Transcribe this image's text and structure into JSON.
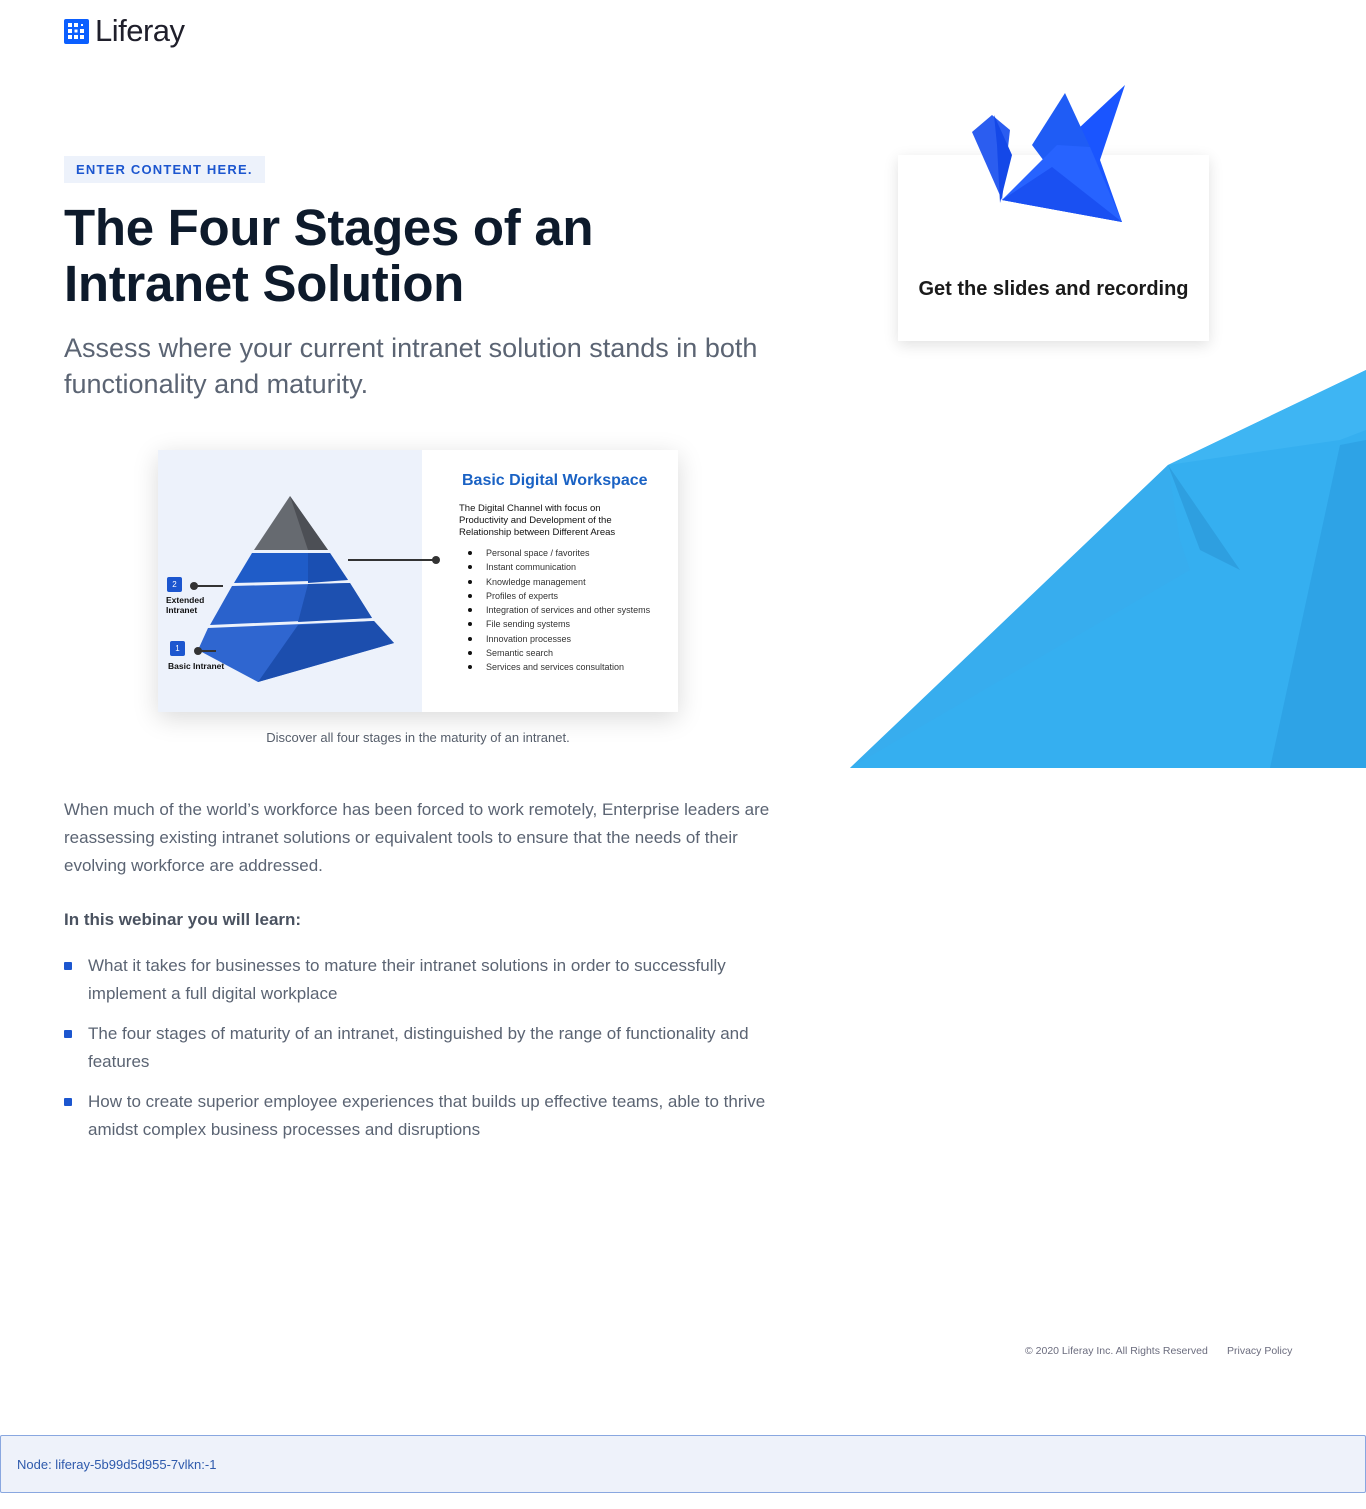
{
  "brand": {
    "name": "Liferay"
  },
  "hero": {
    "eyebrow": "ENTER CONTENT HERE.",
    "title": "The Four Stages of an Intranet Solution",
    "subtitle": "Assess where your current intranet solution stands in both functionality and maturity."
  },
  "figure": {
    "title": "Basic Digital Workspace",
    "subtitle": "The Digital Channel with focus on Productivity and Development of the Relationship between Different Areas",
    "items": [
      "Personal space / favorites",
      "Instant communication",
      "Knowledge management",
      "Profiles of experts",
      "Integration of services and other systems",
      "File sending systems",
      "Innovation processes",
      "Semantic search",
      "Services and services consultation"
    ],
    "pyramid_labels": [
      {
        "badge": "2",
        "label": "Extended Intranet"
      },
      {
        "badge": "1",
        "label": "Basic Intranet"
      }
    ],
    "caption": "Discover all four stages in the maturity of an intranet."
  },
  "body": {
    "intro": "When much of the world’s workforce has been forced to work remotely, Enterprise leaders are reassessing existing intranet solutions or equivalent tools to ensure that the needs of their evolving workforce are addressed.",
    "learn_heading": "In this webinar you will learn:",
    "learn_items": [
      "What it takes for businesses to mature their intranet solutions in order to successfully implement a full digital workplace",
      "The four stages of maturity of an intranet, distinguished by the range of functionality and features",
      "How to create superior employee experiences that builds up effective teams, able to thrive amidst complex business processes and disruptions"
    ]
  },
  "cta": {
    "label": "Get the slides and recording"
  },
  "footer": {
    "copyright": "© 2020 Liferay Inc. All Rights Reserved",
    "privacy": "Privacy Policy"
  },
  "node_bar": {
    "text": "Node: liferay-5b99d5d955-7vlkn:-1"
  },
  "colors": {
    "accent": "#1c56cf",
    "brand_blue": "#0b5fff",
    "sky": "#35aff0"
  }
}
